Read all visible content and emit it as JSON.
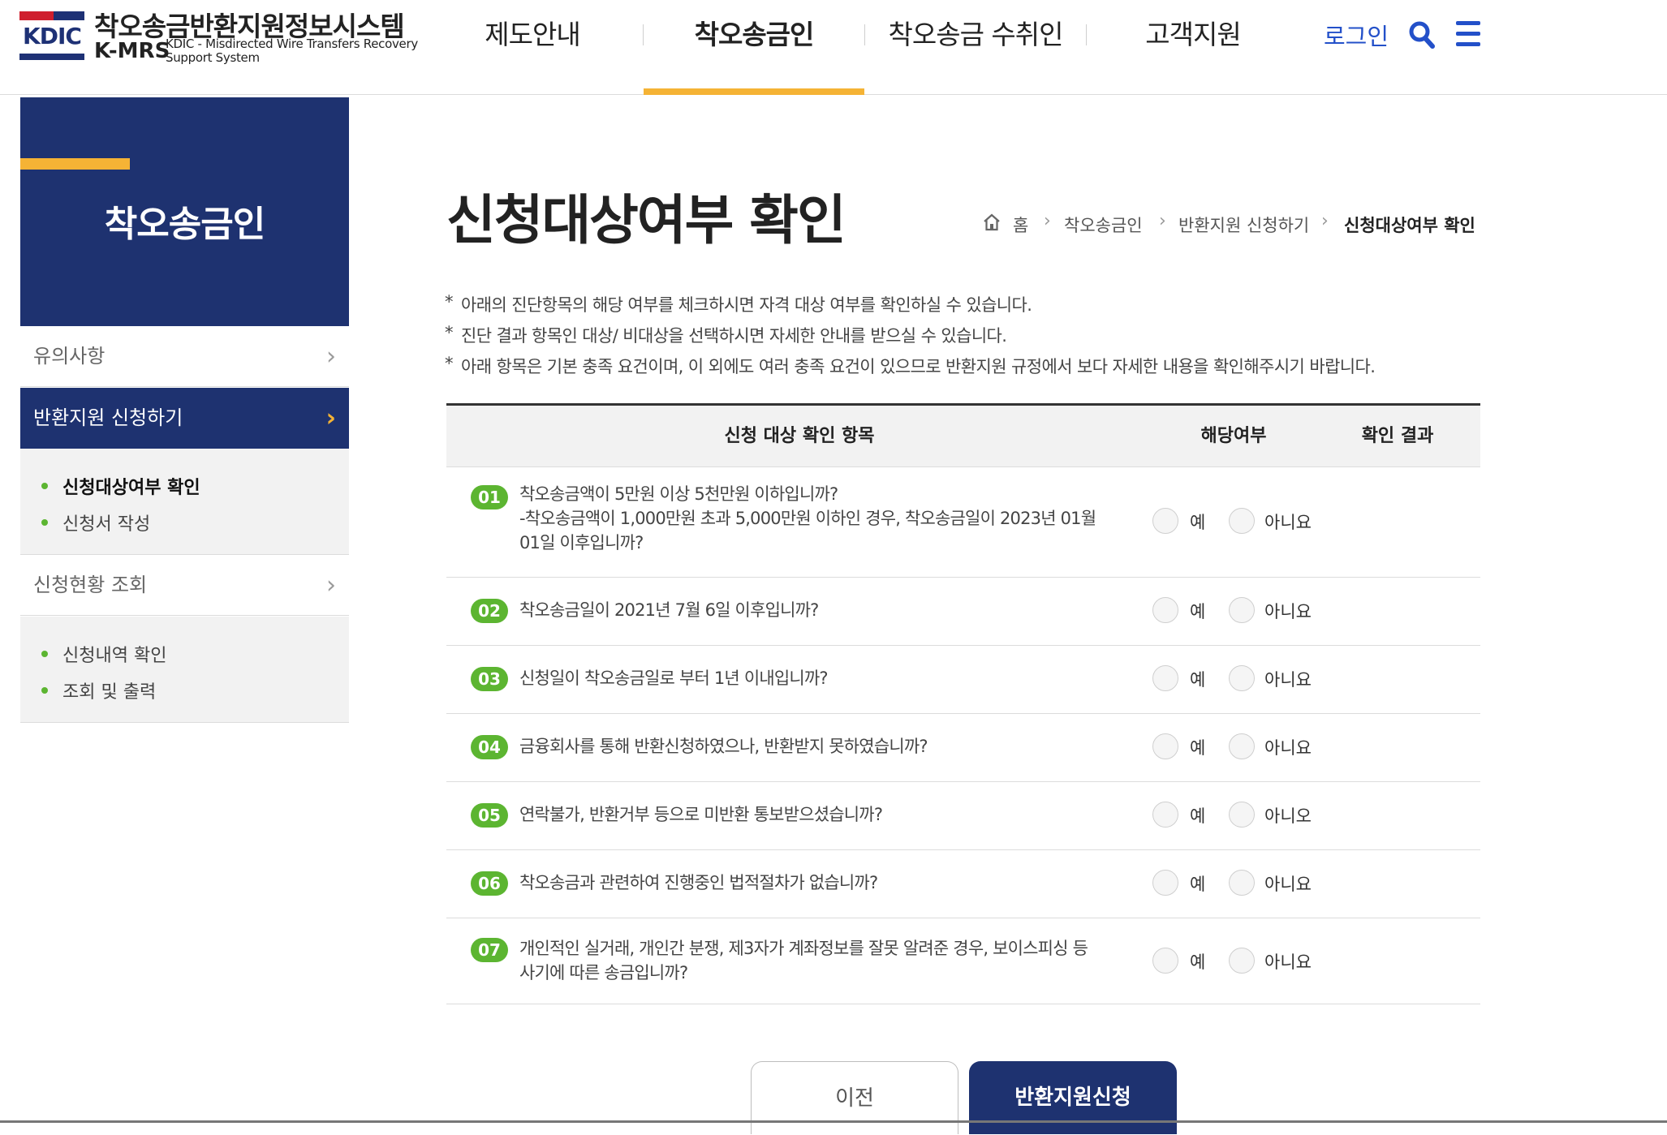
{
  "header": {
    "logo_badge": "KDIC",
    "logo_title": "착오송금반환지원정보시스템",
    "logo_kmrs": "K-MRS",
    "logo_en_line1": "KDIC - Misdirected Wire Transfers Recovery",
    "logo_en_line2": "Support System",
    "nav": [
      "제도안내",
      "착오송금인",
      "착오송금 수취인",
      "고객지원"
    ],
    "login": "로그인"
  },
  "sidebar": {
    "title": "착오송금인",
    "items": [
      {
        "label": "유의사항",
        "chevron": "›"
      },
      {
        "label": "반환지원 신청하기",
        "chevron": "›"
      },
      {
        "label": "신청현황 조회",
        "chevron": "›"
      }
    ],
    "apply_subs": [
      "신청대상여부 확인",
      "신청서 작성"
    ],
    "status_subs": [
      "신청내역 확인",
      "조회 및 출력"
    ]
  },
  "main": {
    "page_title": "신청대상여부 확인",
    "breadcrumb": [
      "홈",
      "착오송금인",
      "반환지원 신청하기",
      "신청대상여부 확인"
    ],
    "breadcrumb_arrow": "›",
    "notes": [
      "아래의 진단항목의 해당 여부를 체크하시면 자격 대상 여부를 확인하실 수 있습니다.",
      "진단 결과 항목인 대상/ 비대상을 선택하시면 자세한 안내를 받으실 수 있습니다.",
      "아래 항목은 기본 충족 요건이며, 이 외에도 여러 충족 요건이 있으므로 반환지원 규정에서 보다 자세한 내용을 확인해주시기 바랍니다."
    ],
    "table_headers": [
      "신청 대상 확인 항목",
      "해당여부",
      "확인 결과"
    ],
    "questions": [
      {
        "num": "01",
        "text": "착오송금액이 5만원 이상 5천만원 이하입니까?",
        "sub": "-착오송금액이 1,000만원 초과 5,000만원 이하인 경우, 착오송금일이 2023년 01월 01일 이후입니까?",
        "yes": "예",
        "no": "아니요"
      },
      {
        "num": "02",
        "text": "착오송금일이 2021년 7월 6일 이후입니까?",
        "sub": "",
        "yes": "예",
        "no": "아니요"
      },
      {
        "num": "03",
        "text": "신청일이 착오송금일로 부터 1년 이내입니까?",
        "sub": "",
        "yes": "예",
        "no": "아니요"
      },
      {
        "num": "04",
        "text": "금융회사를 통해 반환신청하였으나, 반환받지 못하였습니까?",
        "sub": "",
        "yes": "예",
        "no": "아니요"
      },
      {
        "num": "05",
        "text": "연락불가, 반환거부 등으로 미반환 통보받으셨습니까?",
        "sub": "",
        "yes": "예",
        "no": "아니오"
      },
      {
        "num": "06",
        "text": "착오송금과 관련하여 진행중인 법적절차가 없습니까?",
        "sub": "",
        "yes": "예",
        "no": "아니요"
      },
      {
        "num": "07",
        "text": "개인적인 실거래, 개인간 분쟁, 제3자가 계좌정보를 잘못 알려준 경우, 보이스피싱 등 사기에 따른 송금입니까?",
        "sub": "",
        "yes": "예",
        "no": "아니요"
      }
    ],
    "buttons": {
      "prev": "이전",
      "apply": "반환지원신청"
    }
  },
  "colors": {
    "navy": "#1e3270",
    "accent": "#f5b335",
    "green": "#5cb531",
    "link": "#2350c9"
  }
}
